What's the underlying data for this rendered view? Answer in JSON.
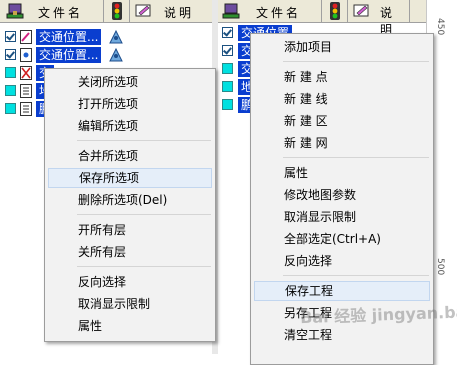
{
  "left_panel": {
    "headers": {
      "name": "文件名",
      "desc": "说明"
    },
    "layers": [
      {
        "name": "交通位置...",
        "checked": true,
        "selected": true,
        "icon": "line-layer-icon"
      },
      {
        "name": "交通位置...",
        "checked": true,
        "selected": true,
        "icon": "point-layer-icon"
      },
      {
        "name": "交",
        "checked": false,
        "selected": true,
        "icon": "region-layer-icon"
      },
      {
        "name": "地",
        "checked": false,
        "selected": true,
        "icon": "doc-layer-icon"
      },
      {
        "name": "鹏",
        "checked": false,
        "selected": true,
        "icon": "doc-layer-icon"
      }
    ]
  },
  "right_panel": {
    "headers": {
      "name": "文件名",
      "desc": "说明"
    },
    "layers": [
      {
        "name": "交通位置",
        "checked": true
      },
      {
        "name": "交通位置",
        "checked": true
      },
      {
        "name": "交",
        "checked": false
      },
      {
        "name": "地",
        "checked": false
      },
      {
        "name": "鹏",
        "checked": false
      }
    ],
    "ruler_labels": [
      "450",
      "500"
    ]
  },
  "context_menu_left": {
    "items": [
      {
        "label": "关闭所选项",
        "highlighted": false
      },
      {
        "label": "打开所选项",
        "highlighted": false
      },
      {
        "label": "编辑所选项",
        "highlighted": false
      },
      {
        "label": "合并所选项",
        "highlighted": false
      },
      {
        "label": "保存所选项",
        "highlighted": true
      },
      {
        "label": "删除所选项(Del)",
        "highlighted": false
      },
      {
        "label": "开所有层",
        "highlighted": false
      },
      {
        "label": "关所有层",
        "highlighted": false
      },
      {
        "label": "反向选择",
        "highlighted": false
      },
      {
        "label": "取消显示限制",
        "highlighted": false
      },
      {
        "label": "属性",
        "highlighted": false
      }
    ]
  },
  "context_menu_right": {
    "items": [
      {
        "label": "添加项目",
        "highlighted": false
      },
      {
        "label": "新 建 点",
        "highlighted": false
      },
      {
        "label": "新 建 线",
        "highlighted": false
      },
      {
        "label": "新 建 区",
        "highlighted": false
      },
      {
        "label": "新 建 网",
        "highlighted": false
      },
      {
        "label": "属性",
        "highlighted": false
      },
      {
        "label": "修改地图参数",
        "highlighted": false
      },
      {
        "label": "取消显示限制",
        "highlighted": false
      },
      {
        "label": "全部选定(Ctrl+A)",
        "highlighted": false
      },
      {
        "label": "反向选择",
        "highlighted": false
      },
      {
        "label": "保存工程",
        "highlighted": true
      },
      {
        "label": "另存工程",
        "highlighted": false
      },
      {
        "label": "清空工程",
        "highlighted": false
      }
    ]
  },
  "watermark": "Bai 经验 jingyan.baidu.com",
  "colors": {
    "selection": "#0a3ecf",
    "menu_bg": "#f2f2f2",
    "highlight": "#e5eef9",
    "header_bg": "#ece9d8"
  }
}
